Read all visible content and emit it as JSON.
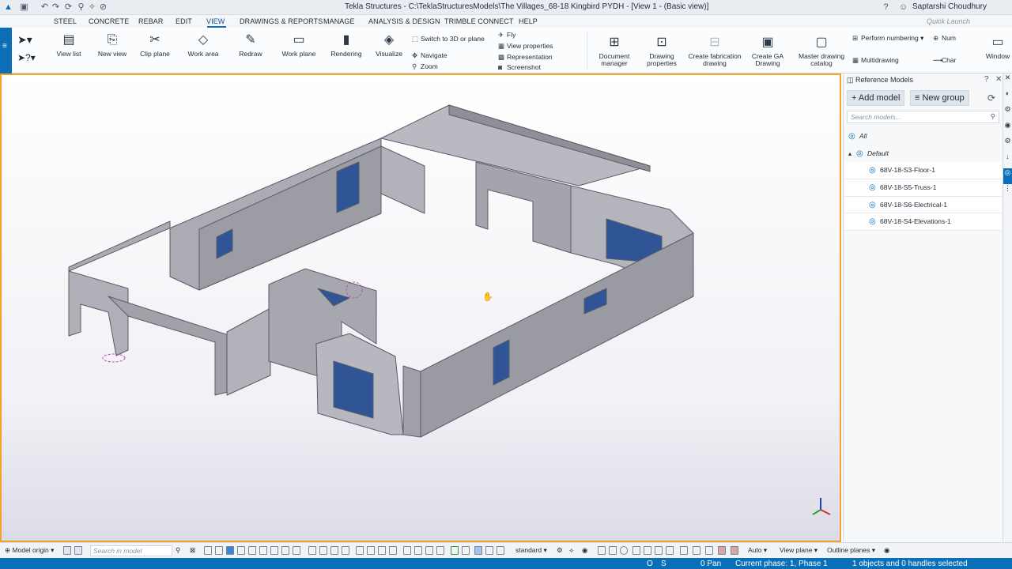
{
  "window": {
    "title": "Tekla Structures - C:\\TeklaStructuresModels\\The Villages_68-18 Kingbird PYDH - [View 1 - (Basic view)]",
    "user": "Saptarshi Choudhury"
  },
  "menu": {
    "tabs": [
      "STEEL",
      "CONCRETE",
      "REBAR",
      "EDIT",
      "VIEW",
      "DRAWINGS & REPORTS",
      "MANAGE",
      "ANALYSIS & DESIGN",
      "TRIMBLE CONNECT",
      "HELP"
    ],
    "quick_launch_placeholder": "Quick Launch"
  },
  "ribbon": {
    "view_list": "View list",
    "new_view": "New view",
    "clip_plane": "Clip plane",
    "work_area": "Work area",
    "redraw": "Redraw",
    "work_plane": "Work plane",
    "rendering": "Rendering",
    "visualize": "Visualize",
    "switch_3d": "Switch to 3D or plane",
    "navigate": "Navigate",
    "zoom": "Zoom",
    "fly": "Fly",
    "view_properties": "View properties",
    "representation": "Representation",
    "screenshot": "Screenshot",
    "document_manager": "Document manager",
    "drawing_properties": "Drawing properties",
    "create_fabrication_drawing": "Create fabrication drawing",
    "create_ga_drawing": "Create GA Drawing",
    "master_drawing_catalog": "Master drawing catalog",
    "perform_numbering": "Perform numbering",
    "multidrawing": "Multidrawing",
    "num": "Num",
    "char": "Char",
    "window": "Window"
  },
  "panel": {
    "title": "Reference Models",
    "add_model": "+ Add model",
    "new_group": "≡ New group",
    "search_placeholder": "Search models...",
    "tree": {
      "all": "All",
      "default": "Default",
      "items": [
        "68V-18-S3-Floor-1",
        "68V-18-S5-Truss-1",
        "68V-18-S6-Electrical-1",
        "68V-18-S4-Elevations-1"
      ]
    }
  },
  "statusbar": {
    "model_origin": "Model origin",
    "search_placeholder": "Search in model",
    "standard": "standard",
    "auto": "Auto",
    "view_plane": "View plane",
    "outline_planes": "Outline planes"
  },
  "bottombar": {
    "o": "O",
    "s": "S",
    "pan": "0 Pan",
    "phase": "Current phase: 1, Phase 1",
    "selection": "1 objects and 0 handles selected"
  },
  "colors": {
    "accent": "#0b6fb8",
    "selection_border": "#f0a52a",
    "panel_fill": "#a9a9b0",
    "window_fill": "#2f5596"
  }
}
